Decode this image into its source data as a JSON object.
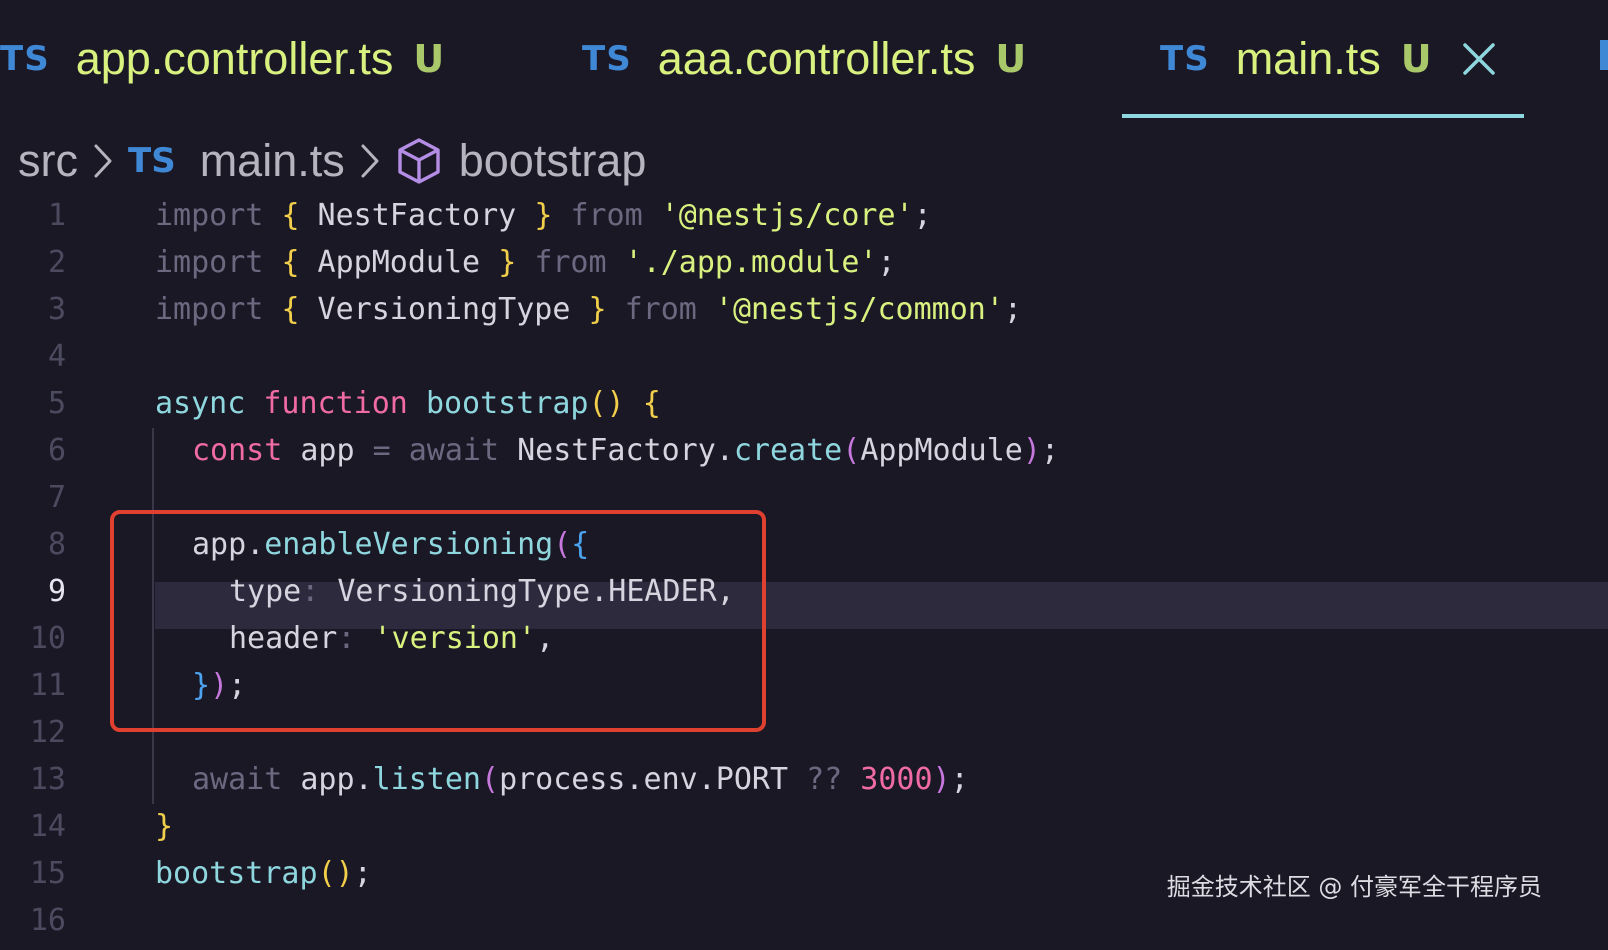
{
  "tabs": [
    {
      "lang": "TS",
      "filename": "app.controller.ts",
      "status": "U",
      "active": false
    },
    {
      "lang": "TS",
      "filename": "aaa.controller.ts",
      "status": "U",
      "active": false
    },
    {
      "lang": "TS",
      "filename": "main.ts",
      "status": "U",
      "active": true
    }
  ],
  "breadcrumb": {
    "folder": "src",
    "file_lang": "TS",
    "file": "main.ts",
    "symbol_icon": "cube-icon",
    "symbol": "bootstrap"
  },
  "editor": {
    "active_line": 9,
    "line_numbers": [
      "1",
      "2",
      "3",
      "4",
      "5",
      "6",
      "7",
      "8",
      "9",
      "10",
      "11",
      "12",
      "13",
      "14",
      "15",
      "16"
    ],
    "code": {
      "l1": {
        "kw": "import",
        "b1": "{",
        "id": " NestFactory ",
        "b2": "}",
        "from": "from",
        "str": "'@nestjs/core'",
        "end": ";"
      },
      "l2": {
        "kw": "import",
        "b1": "{",
        "id": " AppModule ",
        "b2": "}",
        "from": "from",
        "str": "'./app.module'",
        "end": ";"
      },
      "l3": {
        "kw": "import",
        "b1": "{",
        "id": " VersioningType ",
        "b2": "}",
        "from": "from",
        "str": "'@nestjs/common'",
        "end": ";"
      },
      "l5": {
        "async": "async",
        "function": "function",
        "name": "bootstrap",
        "parens": "()",
        "brace": "{"
      },
      "l6": {
        "const": "const",
        "var": "app",
        "eq": "=",
        "await": "await",
        "obj": "NestFactory",
        "dot": ".",
        "method": "create",
        "po": "(",
        "arg": "AppModule",
        "pc": ")",
        "end": ";"
      },
      "l8": {
        "obj": "app",
        "dot": ".",
        "method": "enableVersioning",
        "po": "(",
        "bo": "{"
      },
      "l9": {
        "key": "type",
        "colon": ": ",
        "value": "VersioningType.HEADER",
        "comma": ","
      },
      "l10": {
        "key": "header",
        "colon": ": ",
        "str": "'version'",
        "comma": ","
      },
      "l11": {
        "bc": "}",
        "pc": ")",
        "end": ";"
      },
      "l13": {
        "await": "await",
        "obj": "app",
        "dot": ".",
        "method": "listen",
        "po": "(",
        "arg": "process.env.PORT",
        "op": "??",
        "num": "3000",
        "pc": ")",
        "end": ";"
      },
      "l14": {
        "brace": "}"
      },
      "l15": {
        "name": "bootstrap",
        "parens": "()",
        "end": ";"
      }
    }
  },
  "watermark": "掘金技术社区 @ 付豪军全干程序员",
  "colors": {
    "background": "#1b1826",
    "ts_badge": "#3f88d6",
    "filename": "#d9f27f",
    "active_tab_underline": "#8fd7de",
    "highlight_box": "#e0402f"
  }
}
